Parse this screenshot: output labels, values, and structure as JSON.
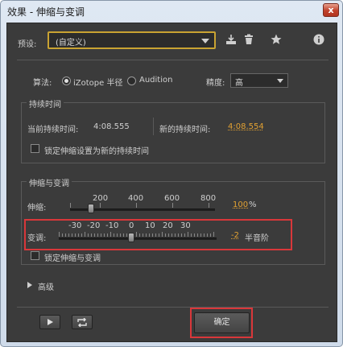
{
  "window": {
    "title": "效果 - 伸缩与变调",
    "close_label": "x"
  },
  "preset": {
    "label": "预设:",
    "value": "(自定义)"
  },
  "icons": {
    "dropdown": "chevron-down-icon",
    "save": "download-icon",
    "delete": "trash-icon",
    "favorite": "star-icon",
    "info": "info-icon"
  },
  "algorithm": {
    "label": "算法:",
    "options": [
      "iZotope 半径",
      "Audition"
    ],
    "selected": "iZotope 半径"
  },
  "precision": {
    "label": "精度:",
    "value": "高"
  },
  "duration": {
    "title": "持续时间",
    "current_label": "当前持续时间:",
    "current_value": "4:08.555",
    "new_label": "新的持续时间:",
    "new_value": "4:08.554",
    "lock_label": "锁定伸缩设置为新的持续时间"
  },
  "stretch_pitch": {
    "title": "伸缩与变调",
    "stretch": {
      "label": "伸缩:",
      "ticks": [
        "200",
        "400",
        "600",
        "800"
      ],
      "value": "100",
      "unit": "%",
      "level": 100
    },
    "pitch": {
      "label": "变调:",
      "ticks": [
        "-30",
        "-20",
        "-10",
        "0",
        "10",
        "20",
        "30"
      ],
      "value": "-2",
      "unit": "半音阶",
      "level": -2
    },
    "lock_label": "锁定伸缩与变调"
  },
  "advanced": {
    "label": "高级"
  },
  "footer": {
    "ok_label": "确定"
  },
  "colors": {
    "accent": "#e3a232",
    "highlight": "#d9373a",
    "panel": "#3b3b3b"
  }
}
